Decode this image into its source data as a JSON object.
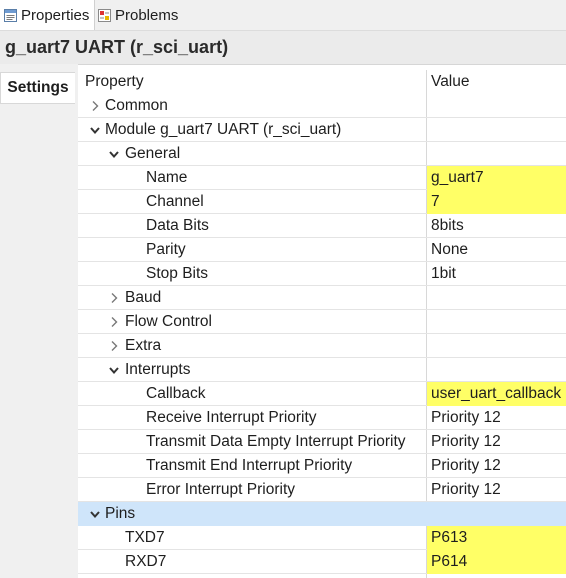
{
  "tabs": [
    {
      "label": "Properties",
      "icon": "properties-icon"
    },
    {
      "label": "Problems",
      "icon": "problems-icon"
    }
  ],
  "header": {
    "title": "g_uart7 UART (r_sci_uart)"
  },
  "side_tabs": [
    {
      "label": "Settings"
    }
  ],
  "columns": {
    "property": "Property",
    "value": "Value"
  },
  "rows": [
    {
      "label": "Common",
      "value": "",
      "level": 0,
      "expander": "collapsed"
    },
    {
      "label": "Module g_uart7 UART (r_sci_uart)",
      "value": "",
      "level": 0,
      "expander": "expanded"
    },
    {
      "label": "General",
      "value": "",
      "level": 1,
      "expander": "expanded"
    },
    {
      "label": "Name",
      "value": "g_uart7",
      "level": 3,
      "expander": "none",
      "highlight": true
    },
    {
      "label": "Channel",
      "value": "7",
      "level": 3,
      "expander": "none",
      "highlight": true
    },
    {
      "label": "Data Bits",
      "value": "8bits",
      "level": 3,
      "expander": "none"
    },
    {
      "label": "Parity",
      "value": "None",
      "level": 3,
      "expander": "none"
    },
    {
      "label": "Stop Bits",
      "value": "1bit",
      "level": 3,
      "expander": "none"
    },
    {
      "label": "Baud",
      "value": "",
      "level": 1,
      "expander": "collapsed"
    },
    {
      "label": "Flow Control",
      "value": "",
      "level": 1,
      "expander": "collapsed"
    },
    {
      "label": "Extra",
      "value": "",
      "level": 1,
      "expander": "collapsed"
    },
    {
      "label": "Interrupts",
      "value": "",
      "level": 1,
      "expander": "expanded"
    },
    {
      "label": "Callback",
      "value": "user_uart_callback",
      "level": 3,
      "expander": "none",
      "highlight": true
    },
    {
      "label": "Receive Interrupt Priority",
      "value": "Priority 12",
      "level": 3,
      "expander": "none"
    },
    {
      "label": "Transmit Data Empty Interrupt Priority",
      "value": "Priority 12",
      "level": 3,
      "expander": "none"
    },
    {
      "label": "Transmit End Interrupt Priority",
      "value": "Priority 12",
      "level": 3,
      "expander": "none"
    },
    {
      "label": "Error Interrupt Priority",
      "value": "Priority 12",
      "level": 3,
      "expander": "none"
    },
    {
      "label": "Pins",
      "value": "",
      "level": 0,
      "expander": "expanded",
      "selected": true
    },
    {
      "label": "TXD7",
      "value": "P613",
      "level": 2,
      "expander": "none",
      "highlight": true
    },
    {
      "label": "RXD7",
      "value": "P614",
      "level": 2,
      "expander": "none",
      "highlight": true
    }
  ],
  "colors": {
    "highlight": "#ffff66",
    "selection": "#cfe5fa"
  }
}
